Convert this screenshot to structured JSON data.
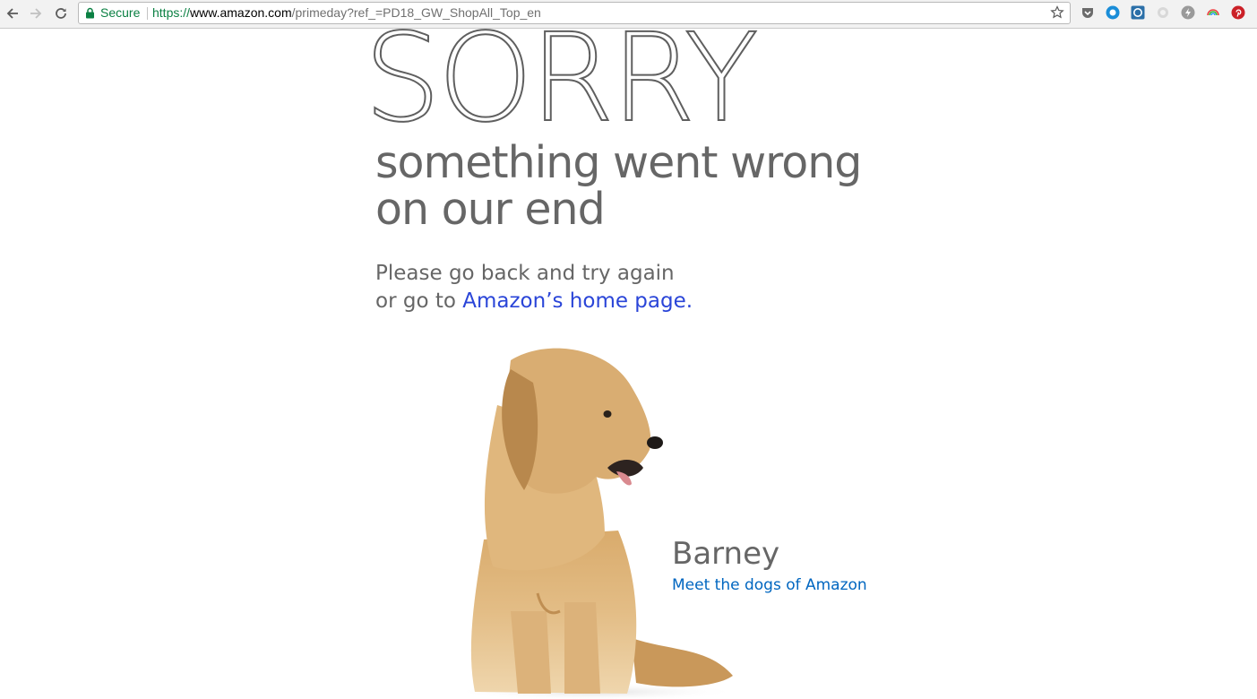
{
  "browser": {
    "secure_label": "Secure",
    "url_scheme": "https://",
    "url_host": "www.amazon.com",
    "url_path": "/primeday?ref_=PD18_GW_ShopAll_Top_en",
    "extensions": [
      "pocket-icon",
      "blue-circle-icon",
      "blue-square-icon",
      "gray-circle-icon",
      "lightning-icon",
      "rainbow-icon",
      "pinterest-icon"
    ]
  },
  "error": {
    "title": "SORRY",
    "subtitle_line1": "something went wrong",
    "subtitle_line2": "on our end",
    "instruction_line1": "Please go back and try again",
    "instruction_line2_prefix": "or go to ",
    "home_link": "Amazon’s home page."
  },
  "dog": {
    "name": "Barney",
    "link": "Meet the dogs of Amazon"
  },
  "colors": {
    "text_gray": "#666666",
    "link_blue": "#2a45d8",
    "dog_link": "#0066c0",
    "secure_green": "#0b8043"
  }
}
